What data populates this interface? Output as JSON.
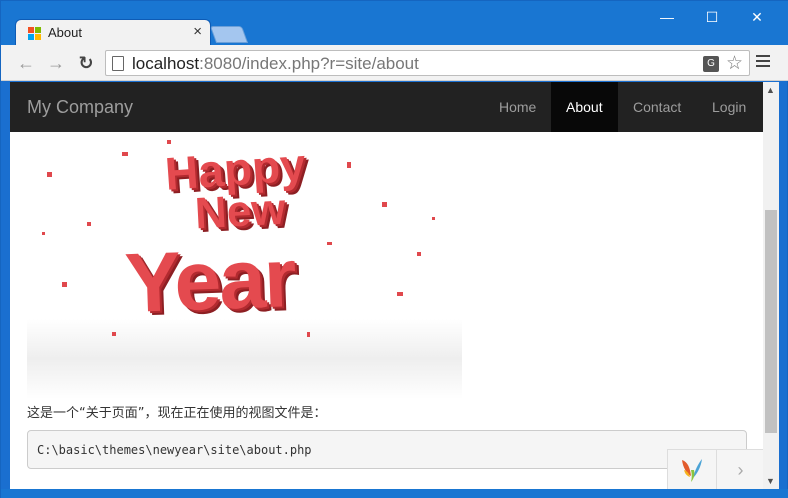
{
  "browser": {
    "tab_title": "About",
    "tab_close": "×",
    "minimize": "—",
    "maximize": "☐",
    "close": "✕",
    "url_host": "localhost",
    "url_rest": ":8080/index.php?r=site/about",
    "back": "←",
    "forward": "→",
    "reload": "↻",
    "translate": "G",
    "bookmark": "☆"
  },
  "site": {
    "brand": "My Company",
    "nav": [
      {
        "label": "Home"
      },
      {
        "label": "About"
      },
      {
        "label": "Contact"
      },
      {
        "label": "Login"
      }
    ],
    "banner_words": [
      "Happy",
      "New",
      "Year"
    ],
    "intro_text": "这是一个“关于页面”，现在正在使用的视图文件是：",
    "view_file": "C:\\basic\\themes\\newyear\\site\\about.php"
  },
  "debug_toolbar": {
    "toggle": "›"
  },
  "colors": {
    "navbar_bg": "#222222",
    "nav_active_bg": "#080808",
    "accent_red": "#e44a4f",
    "chrome_blue": "#1976d2"
  }
}
